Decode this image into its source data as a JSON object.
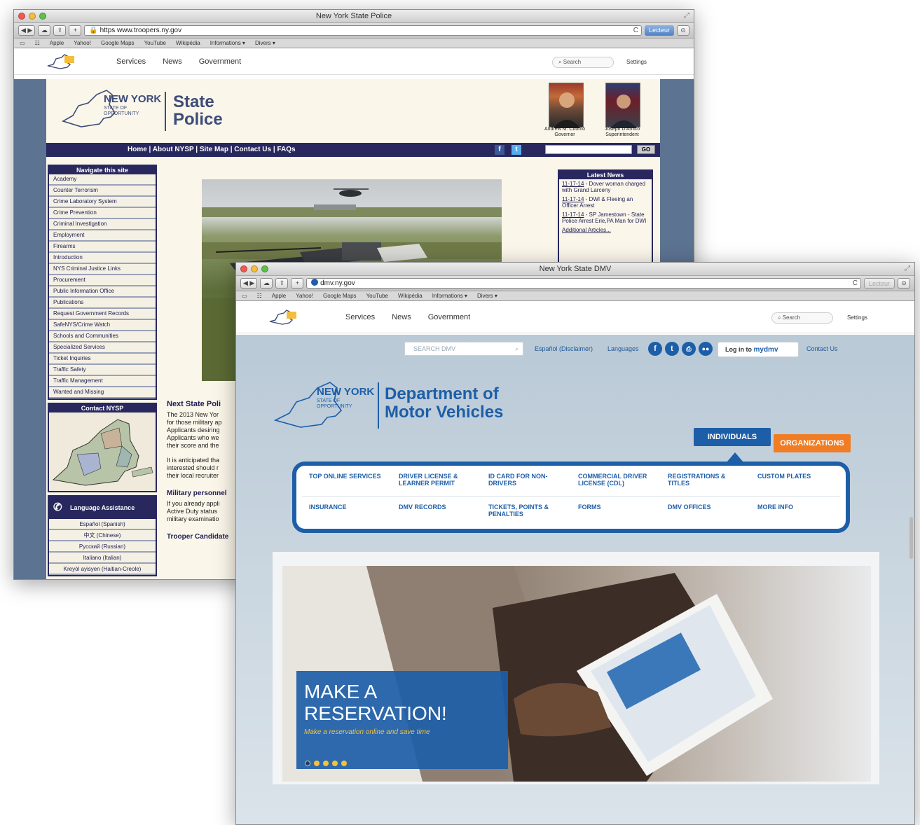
{
  "police_window": {
    "title": "New York State Police",
    "url_prefix": "https",
    "url": "www.troopers.ny.gov",
    "reader": "Lecteur",
    "bookmarks": [
      "Apple",
      "Yahoo!",
      "Google Maps",
      "YouTube",
      "Wikipédia",
      "Informations ▾",
      "Divers ▾"
    ],
    "gov_nav": [
      "Services",
      "News",
      "Government"
    ],
    "gov_search": "Search",
    "gov_settings": "Settings",
    "brand_ny": "NEW YORK",
    "brand_sub1": "STATE OF",
    "brand_sub2": "OPPORTUNITY",
    "site_title_1": "State",
    "site_title_2": "Police",
    "officials": [
      {
        "name": "Andrew M. Cuomo",
        "role": "Governor"
      },
      {
        "name": "Joseph D'Amico",
        "role": "Superintendent"
      }
    ],
    "nav_links": "Home | About NYSP | Site Map | Contact Us | FAQs",
    "go_button": "GO",
    "sidebar_title": "Navigate this site",
    "sidebar_items": [
      "Academy",
      "Counter Terrorism",
      "Crime Laboratory System",
      "Crime Prevention",
      "Criminal Investigation",
      "Employment",
      "Firearms",
      "Introduction",
      "NYS Criminal Justice Links",
      "Procurement",
      "Public Information Office",
      "Publications",
      "Request Government Records",
      "SafeNYS/Crime Watch",
      "Schools and Communities",
      "Specialized Services",
      "Ticket Inquiries",
      "Traffic Safety",
      "Traffic Management",
      "Wanted and Missing"
    ],
    "contact_title": "Contact NYSP",
    "language_title": "Language Assistance",
    "languages": [
      "Español (Spanish)",
      "中文 (Chinese)",
      "Русский (Russian)",
      "Italiano (Italian)",
      "Kreyòl ayisyen (Haitian-Creole)"
    ],
    "news_title": "Latest News",
    "news": [
      {
        "date": "11-17-14",
        "text": " - Dover woman charged with Grand Larceny"
      },
      {
        "date": "11-17-14",
        "text": " - DWI & Fleeing an Officer Arrest"
      },
      {
        "date": "11-17-14",
        "text": " - SP Jamestown - State Police Arrest Erie,PA Man for DWI"
      }
    ],
    "news_more": "Additional Articles...",
    "content_heading": "Next State Poli",
    "content_lines": [
      "The 2013 New Yor",
      "for those military ap",
      "Applicants desiring",
      "Applicants who we",
      "their score and the"
    ],
    "content_lines2": [
      "It is anticipated tha",
      "interested should r",
      "their local recruiter"
    ],
    "military_heading": "Military personnel",
    "military_lines": [
      "If you already appli",
      "Active Duty status",
      "military examinatio"
    ],
    "trooper_heading": "Trooper Candidate"
  },
  "dmv_window": {
    "title": "New York State DMV",
    "url": "dmv.ny.gov",
    "reader": "Lecteur",
    "bookmarks": [
      "Apple",
      "Yahoo!",
      "Google Maps",
      "YouTube",
      "Wikipédia",
      "Informations ▾",
      "Divers ▾"
    ],
    "gov_nav": [
      "Services",
      "News",
      "Government"
    ],
    "gov_search": "Search",
    "gov_settings": "Settings",
    "search_placeholder": "SEARCH DMV",
    "espanol": "Español (Disclaimer)",
    "languages": "Languages",
    "login_prefix": "Log in to ",
    "login_brand": "mydmv",
    "contact": "Contact Us",
    "brand_ny": "NEW YORK",
    "brand_sub1": "STATE OF",
    "brand_sub2": "OPPORTUNITY",
    "title_1": "Department of",
    "title_2": "Motor Vehicles",
    "tab_individuals": "INDIVIDUALS",
    "tab_organizations": "ORGANIZATIONS",
    "menu": [
      "TOP ONLINE SERVICES",
      "DRIVER LICENSE & LEARNER PERMIT",
      "ID CARD FOR NON-DRIVERS",
      "COMMERCIAL DRIVER LICENSE (CDL)",
      "REGISTRATIONS & TITLES",
      "CUSTOM PLATES",
      "INSURANCE",
      "DMV RECORDS",
      "TICKETS, POINTS & PENALTIES",
      "FORMS",
      "DMV OFFICES",
      "MORE INFO"
    ],
    "hero_title_1": "MAKE A",
    "hero_title_2": "RESERVATION!",
    "hero_sub": "Make a reservation online and save time",
    "slide_count": 5,
    "slide_active": 1
  },
  "colors": {
    "police_navy": "#28285f",
    "police_bg": "#5c7391",
    "dmv_blue": "#1d5ea8",
    "dmv_orange": "#f07c24"
  }
}
